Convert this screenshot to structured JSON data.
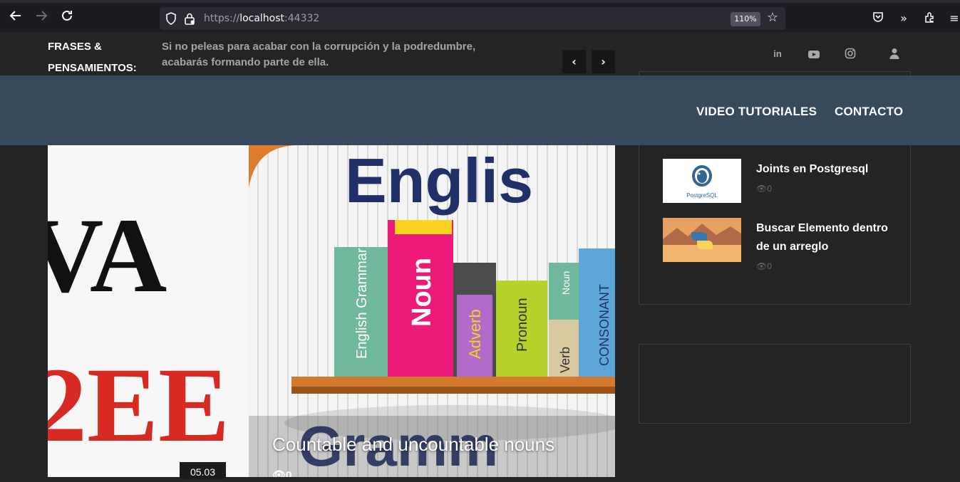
{
  "browser": {
    "url_prefix": "https://",
    "url_host": "localhost",
    "url_port": ":44332",
    "zoom": "110%",
    "back_icon": "arrow-left-icon",
    "forward_icon": "arrow-right-icon",
    "reload_icon": "reload-icon"
  },
  "topbar": {
    "label": "FRASES & PENSAMIENTOS:",
    "quote": "Si no peleas para acabar con la corrupción y la podredumbre, acabarás formando parte de ella.",
    "social": [
      "linkedin-icon",
      "youtube-icon",
      "instagram-icon",
      "user-icon"
    ]
  },
  "nav": {
    "items": [
      "VIDEO TUTORIALES",
      "CONTACTO"
    ]
  },
  "sidebar": {
    "posts": [
      {
        "title": "Joints en Postgresql",
        "views": "0",
        "thumb_text": "PostgreSQL"
      },
      {
        "title": "Buscar Elemento dentro de un arreglo",
        "views": "0"
      }
    ]
  },
  "main": {
    "left_card_text": [
      "VA",
      "2EE"
    ],
    "title": "Countable and uncountable nouns",
    "views": "0",
    "date": "05.03",
    "image_words": [
      "Englis",
      "Gramm"
    ],
    "book_labels": [
      "English Grammar",
      "Noun",
      "Adverb",
      "Pronoun",
      "Verb",
      "Noun",
      "CONSONANT"
    ]
  },
  "colors": {
    "nav_bg": "#364a5c",
    "page_bg": "#222426"
  }
}
